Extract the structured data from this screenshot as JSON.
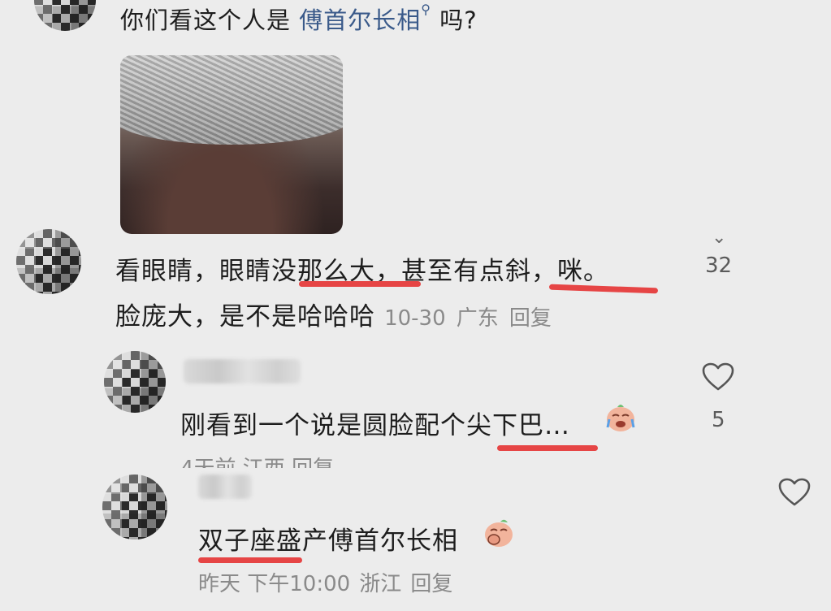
{
  "post": {
    "text_prefix": "你们看这个人是",
    "search_link": "傅首尔长相",
    "text_suffix": "吗?"
  },
  "comment1": {
    "line1_a": "看眼睛，眼睛",
    "line1_b": "没那么大",
    "line1_c": "，甚至有点",
    "line1_d": "斜",
    "line1_e": "，",
    "line1_f": "咪。",
    "line2_text": "脸庞大，是不是哈哈哈",
    "time": "10-30",
    "location": "广东",
    "reply_label": "回复",
    "like_count": "32"
  },
  "comment2": {
    "text_a": "刚看到一个说是圆脸配个",
    "text_b": "尖下巴",
    "text_c": "…",
    "emoji": "crying-face-emoji",
    "meta_partial": "4天前 江西 回复",
    "like_count": "5"
  },
  "comment3": {
    "text_a": "双子座盛",
    "text_b": "产傅首尔长相",
    "emoji": "covering-mouth-face-emoji",
    "time": "昨天 下午10:00",
    "location": "浙江",
    "reply_label": "回复"
  },
  "colors": {
    "background": "#ececec",
    "underline": "#e64545",
    "link": "#3a5a8a",
    "meta": "#8a8a8a"
  }
}
